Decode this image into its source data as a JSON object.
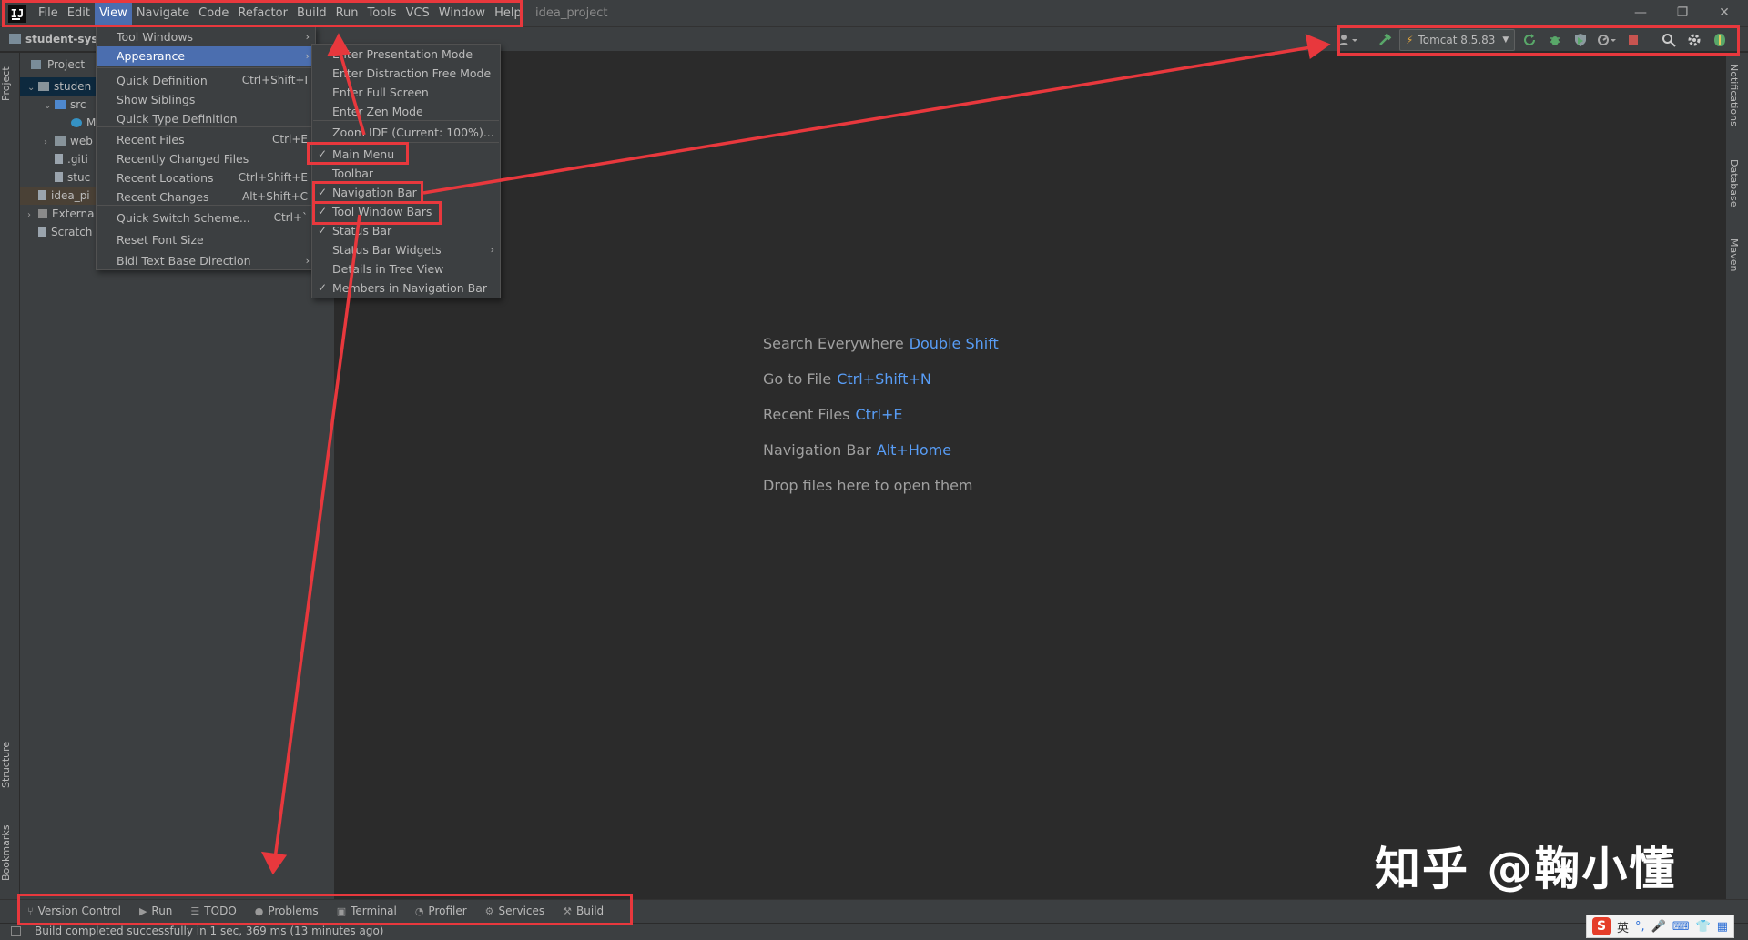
{
  "app": {
    "logo": "IJ",
    "project_title": "idea_project"
  },
  "menubar": {
    "items": [
      {
        "label": "File"
      },
      {
        "label": "Edit"
      },
      {
        "label": "View",
        "active": true
      },
      {
        "label": "Navigate"
      },
      {
        "label": "Code"
      },
      {
        "label": "Refactor"
      },
      {
        "label": "Build"
      },
      {
        "label": "Run"
      },
      {
        "label": "Tools"
      },
      {
        "label": "VCS"
      },
      {
        "label": "Window"
      },
      {
        "label": "Help"
      }
    ]
  },
  "window_controls": {
    "minimize": "—",
    "restore": "❐",
    "close": "✕"
  },
  "navbar": {
    "breadcrumb": "student-syst"
  },
  "toolbar": {
    "run_config": "Tomcat 8.5.83",
    "icons": [
      "user-icon",
      "build-hammer-icon",
      "rerun-icon",
      "debug-icon",
      "coverage-icon",
      "profile-icon",
      "stop-icon",
      "search-icon",
      "settings-icon",
      "plugin-icon"
    ]
  },
  "stripes": {
    "left": {
      "project": "Project",
      "structure": "Structure",
      "bookmarks": "Bookmarks"
    },
    "right": {
      "notifications": "Notifications",
      "database": "Database",
      "maven": "Maven"
    }
  },
  "project_panel": {
    "header": "Project",
    "tree": [
      {
        "label": "studen",
        "indent": 0,
        "arrow": "⌄",
        "icon": "folder"
      },
      {
        "label": "src",
        "indent": 1,
        "arrow": "⌄",
        "icon": "folder src"
      },
      {
        "label": "M",
        "indent": 2,
        "arrow": "",
        "icon": "class"
      },
      {
        "label": "web",
        "indent": 1,
        "arrow": "›",
        "icon": "folder"
      },
      {
        "label": ".giti",
        "indent": 1,
        "arrow": "",
        "icon": "file"
      },
      {
        "label": "stuc",
        "indent": 1,
        "arrow": "",
        "icon": "file"
      },
      {
        "label": "idea_pi",
        "indent": 0,
        "arrow": "",
        "icon": "file"
      },
      {
        "label": "Externa",
        "indent": 0,
        "arrow": "›",
        "icon": "lib"
      },
      {
        "label": "Scratch",
        "indent": 0,
        "arrow": "",
        "icon": "scratch"
      }
    ]
  },
  "view_menu": {
    "items": [
      {
        "label": "Tool Windows",
        "shortcut": "",
        "submenu": true
      },
      {
        "label": "Appearance",
        "shortcut": "",
        "submenu": true,
        "selected": true
      },
      {
        "label": "Quick Definition",
        "shortcut": "Ctrl+Shift+I"
      },
      {
        "label": "Show Siblings",
        "shortcut": ""
      },
      {
        "label": "Quick Type Definition",
        "shortcut": ""
      },
      {
        "label": "Recent Files",
        "shortcut": "Ctrl+E"
      },
      {
        "label": "Recently Changed Files",
        "shortcut": ""
      },
      {
        "label": "Recent Locations",
        "shortcut": "Ctrl+Shift+E"
      },
      {
        "label": "Recent Changes",
        "shortcut": "Alt+Shift+C"
      },
      {
        "label": "Quick Switch Scheme...",
        "shortcut": "Ctrl+`"
      },
      {
        "label": "Reset Font Size",
        "shortcut": ""
      },
      {
        "label": "Bidi Text Base Direction",
        "shortcut": "",
        "submenu": true
      }
    ]
  },
  "appearance_menu": {
    "items": [
      {
        "label": "Enter Presentation Mode",
        "checked": false
      },
      {
        "label": "Enter Distraction Free Mode",
        "checked": false
      },
      {
        "label": "Enter Full Screen",
        "checked": false
      },
      {
        "label": "Enter Zen Mode",
        "checked": false
      },
      {
        "label": "Zoom IDE (Current: 100%)...",
        "checked": false
      },
      {
        "label": "Main Menu",
        "checked": true
      },
      {
        "label": "Toolbar",
        "checked": false
      },
      {
        "label": "Navigation Bar",
        "checked": true
      },
      {
        "label": "Tool Window Bars",
        "checked": true
      },
      {
        "label": "Status Bar",
        "checked": true
      },
      {
        "label": "Status Bar Widgets",
        "checked": false,
        "submenu": true
      },
      {
        "label": "Details in Tree View",
        "checked": false
      },
      {
        "label": "Members in Navigation Bar",
        "checked": true
      }
    ]
  },
  "editor_hints": [
    {
      "text": "Search Everywhere",
      "shortcut": "Double Shift"
    },
    {
      "text": "Go to File",
      "shortcut": "Ctrl+Shift+N"
    },
    {
      "text": "Recent Files",
      "shortcut": "Ctrl+E"
    },
    {
      "text": "Navigation Bar",
      "shortcut": "Alt+Home"
    },
    {
      "text": "Drop files here to open them",
      "shortcut": ""
    }
  ],
  "bottom_tools": [
    {
      "label": "Version Control",
      "glyph": "⑂"
    },
    {
      "label": "Run",
      "glyph": "▶"
    },
    {
      "label": "TODO",
      "glyph": "☰"
    },
    {
      "label": "Problems",
      "glyph": "●"
    },
    {
      "label": "Terminal",
      "glyph": "▣"
    },
    {
      "label": "Profiler",
      "glyph": "◔"
    },
    {
      "label": "Services",
      "glyph": "⚙"
    },
    {
      "label": "Build",
      "glyph": "⚒"
    }
  ],
  "status_bar": {
    "message": "Build completed successfully in 1 sec, 369 ms (13 minutes ago)"
  },
  "watermark": "知乎 @鞠小懂",
  "ime": {
    "logo": "S",
    "lang": "英"
  },
  "colors": {
    "annotation_red": "#e8383d",
    "accent_blue": "#4b6eaf",
    "shortcut_blue": "#589df6"
  }
}
